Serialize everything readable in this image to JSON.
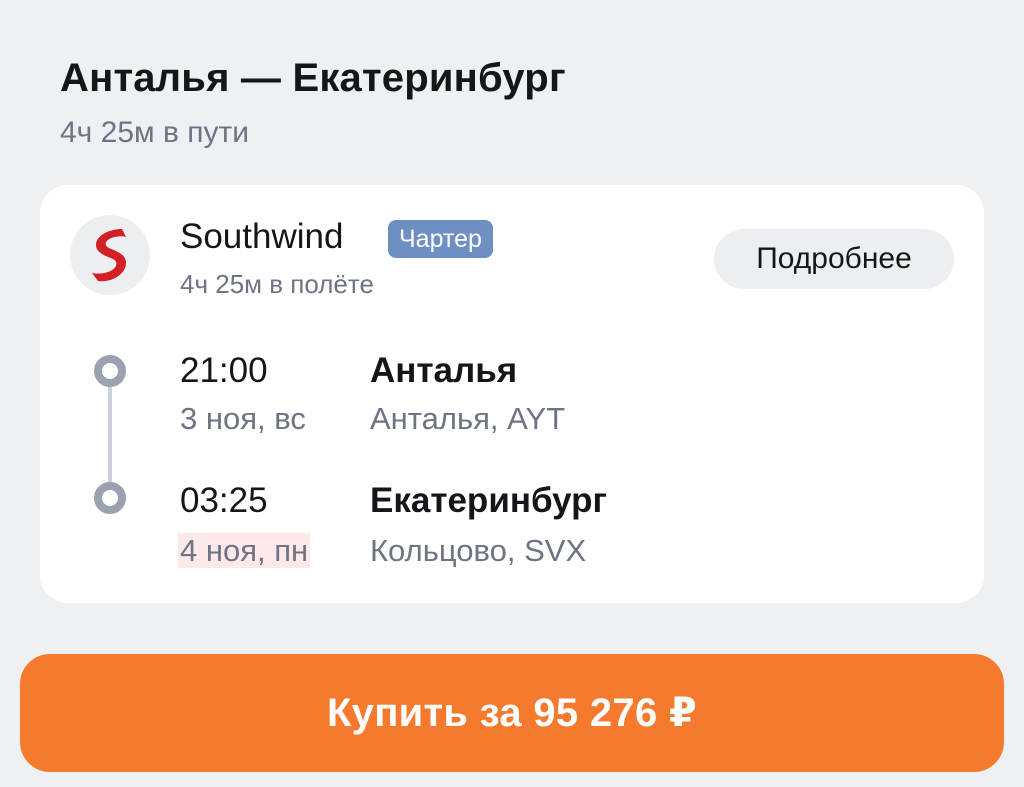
{
  "header": {
    "title": "Анталья — Екатеринбург",
    "total_duration": "4ч 25м в пути"
  },
  "flight": {
    "airline": {
      "name": "Southwind",
      "badge": "Чартер",
      "flight_duration": "4ч 25м в полёте",
      "logo_icon": "southwind-logo-icon",
      "logo_color": "#D32027"
    },
    "details_label": "Подробнее",
    "departure": {
      "time": "21:00",
      "date": "3 ноя, вс",
      "city": "Анталья",
      "airport": "Анталья, AYT"
    },
    "arrival": {
      "time": "03:25",
      "date": "4 ноя, пн",
      "city": "Екатеринбург",
      "airport": "Кольцово, SVX"
    }
  },
  "purchase": {
    "label": "Купить за 95 276 ₽",
    "accent": "#F57A2E"
  }
}
